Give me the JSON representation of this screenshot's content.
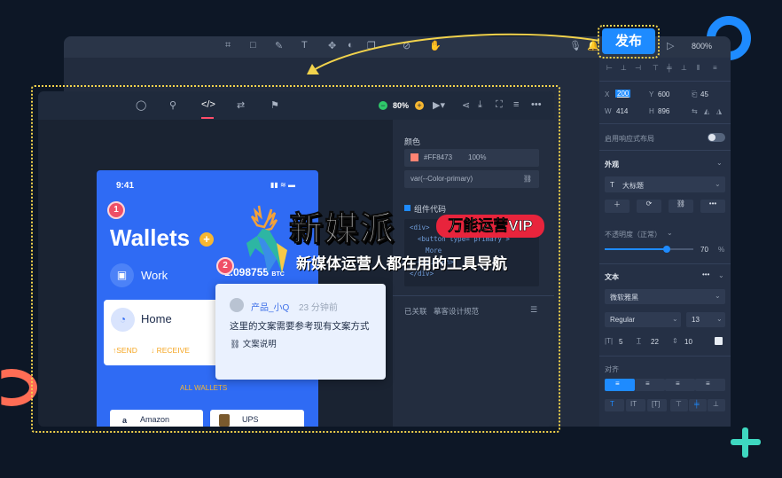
{
  "publish_button": "发布",
  "back_window": {
    "toolbar_icons": [
      "frame-icon",
      "rect-icon",
      "pen-icon",
      "text-icon",
      "component-icon",
      "mask-icon",
      "boolean-icon",
      "slice-icon",
      "hand-icon"
    ],
    "zoom": "800%"
  },
  "right_panel": {
    "x_label": "X",
    "x_value": "200",
    "y_label": "Y",
    "y_value": "600",
    "l_label": "L",
    "l_value": "45",
    "w_label": "W",
    "w_value": "414",
    "h_label": "H",
    "h_value": "896",
    "responsive_label": "启用响应式布局",
    "appearance_title": "外观",
    "style_select": "大标题",
    "opacity_label": "不透明度（正常）",
    "opacity_value": "70",
    "opacity_unit": "%",
    "opacity_fraction": 0.7,
    "text_title": "文本",
    "font_family": "微软雅黑",
    "font_weight": "Regular",
    "font_size": "13",
    "letter_spacing": "5",
    "line_height": "22",
    "paragraph_spacing": "10",
    "align_title": "对齐"
  },
  "front_window": {
    "zoom": "80%",
    "panel": {
      "color_title": "颜色",
      "color_hex": "#FF8473",
      "color_opacity": "100%",
      "color_var": "var(--Color-primary)",
      "code_title": "组件代码",
      "code_lines": [
        "<div>",
        "  <button type=\"primary\">",
        "    More",
        "  </button>",
        "</div>"
      ],
      "linked_label": "已关联",
      "linked_value": "摹客设计规范"
    }
  },
  "phone": {
    "time": "9:41",
    "title": "Wallets",
    "work_label": "Work",
    "btc_value": "1.098755",
    "btc_unit": "BTC",
    "home_label": "Home",
    "send_label": "↑SEND",
    "receive_label": "↓ RECEIVE",
    "all_wallets": "ALL WALLETS",
    "card1": "Amazon",
    "card2": "UPS"
  },
  "badges": [
    "1",
    "2"
  ],
  "comment": {
    "user": "产品_小Q",
    "time": "23 分钟前",
    "text": "这里的文案需要参考现有文案方式",
    "link": "文案说明"
  },
  "watermark": {
    "brand": "新媒派",
    "badge": "万能运营VIP",
    "tagline": "新媒体运营人都在用的工具导航"
  },
  "colors": {
    "accent": "#1e8bff",
    "selection": "#f2d34c",
    "phone_bg": "#2f6bf4",
    "badge": "#ef4f67",
    "primary_swatch": "#FF8473"
  }
}
